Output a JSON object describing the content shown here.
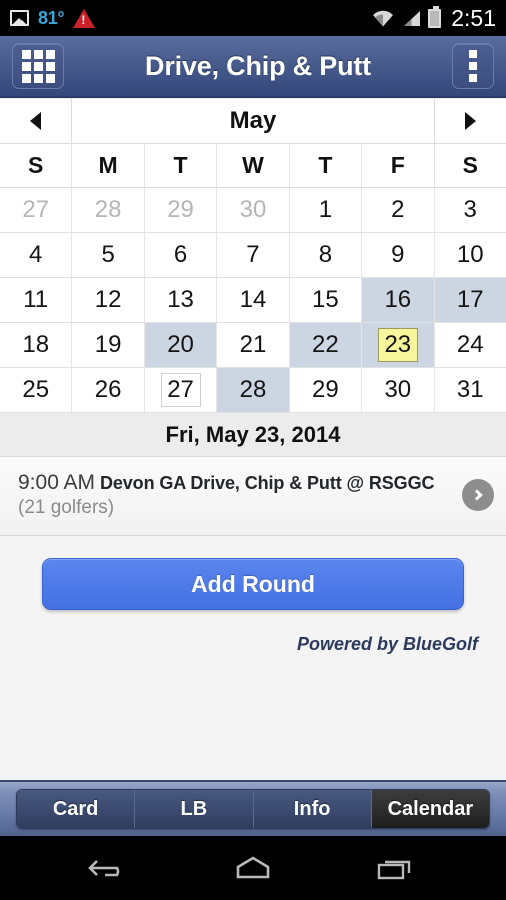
{
  "status_bar": {
    "photo_icon": "photo-icon",
    "temperature": "81°",
    "warning_icon": "warning-triangle-icon",
    "wifi_icon": "wifi-icon",
    "signal_icon": "cell-signal-icon",
    "battery_icon": "battery-icon",
    "clock": "2:51"
  },
  "action_bar": {
    "grid_button": "grid-menu-icon",
    "title": "Drive, Chip & Putt",
    "overflow_button": "overflow-menu-icon"
  },
  "calendar": {
    "prev_label": "◀",
    "next_label": "▶",
    "month": "May",
    "weekdays": [
      "S",
      "M",
      "T",
      "W",
      "T",
      "F",
      "S"
    ],
    "weeks": [
      [
        {
          "d": "27",
          "other": true
        },
        {
          "d": "28",
          "other": true
        },
        {
          "d": "29",
          "other": true
        },
        {
          "d": "30",
          "other": true
        },
        {
          "d": "1"
        },
        {
          "d": "2"
        },
        {
          "d": "3"
        }
      ],
      [
        {
          "d": "4"
        },
        {
          "d": "5"
        },
        {
          "d": "6"
        },
        {
          "d": "7"
        },
        {
          "d": "8"
        },
        {
          "d": "9"
        },
        {
          "d": "10"
        }
      ],
      [
        {
          "d": "11"
        },
        {
          "d": "12"
        },
        {
          "d": "13"
        },
        {
          "d": "14"
        },
        {
          "d": "15"
        },
        {
          "d": "16",
          "event": true
        },
        {
          "d": "17",
          "event": true
        }
      ],
      [
        {
          "d": "18"
        },
        {
          "d": "19"
        },
        {
          "d": "20",
          "event": true
        },
        {
          "d": "21"
        },
        {
          "d": "22",
          "event": true
        },
        {
          "d": "23",
          "event": true,
          "selected": true
        },
        {
          "d": "24"
        }
      ],
      [
        {
          "d": "25"
        },
        {
          "d": "26"
        },
        {
          "d": "27",
          "today": true
        },
        {
          "d": "28",
          "event": true
        },
        {
          "d": "29"
        },
        {
          "d": "30"
        },
        {
          "d": "31"
        }
      ]
    ],
    "highlight_color": "#ccd6e3",
    "selected_color": "#f8f69c"
  },
  "selected_date": "Fri, May 23, 2014",
  "events": [
    {
      "time": "9:00 AM",
      "title": "Devon GA Drive, Chip & Putt @ RSGGC",
      "subtitle": "(21 golfers)",
      "chevron": "chevron-right-icon"
    }
  ],
  "actions": {
    "add_round_label": "Add Round",
    "add_round_color": "#4d79e8",
    "powered_by": "Powered by BlueGolf"
  },
  "tabs": [
    {
      "label": "Card",
      "active": false
    },
    {
      "label": "LB",
      "active": false
    },
    {
      "label": "Info",
      "active": false
    },
    {
      "label": "Calendar",
      "active": true
    }
  ],
  "nav_bar": {
    "back": "back-icon",
    "home": "home-icon",
    "recents": "recent-apps-icon"
  }
}
